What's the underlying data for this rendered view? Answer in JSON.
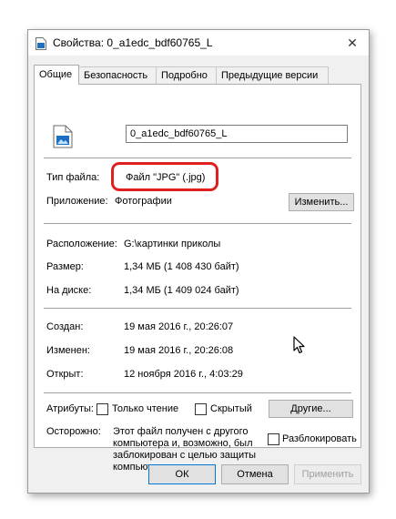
{
  "window": {
    "title": "Свойства: 0_a1edc_bdf60765_L",
    "close_glyph": "✕"
  },
  "tabs": [
    {
      "label": "Общие",
      "active": true
    },
    {
      "label": "Безопасность",
      "active": false
    },
    {
      "label": "Подробно",
      "active": false
    },
    {
      "label": "Предыдущие версии",
      "active": false
    }
  ],
  "general": {
    "file_name": "0_a1edc_bdf60765_L",
    "type_label": "Тип файла:",
    "type_value": "Файл \"JPG\" (.jpg)",
    "app_label": "Приложение:",
    "app_value": "Фотографии",
    "change_button": "Изменить...",
    "location_label": "Расположение:",
    "location_value": "G:\\картинки приколы",
    "size_label": "Размер:",
    "size_value": "1,34 МБ (1 408 430 байт)",
    "disk_label": "На диске:",
    "disk_value": "1,34 МБ (1 409 024 байт)",
    "created_label": "Создан:",
    "created_value": "19 мая 2016 г., 20:26:07",
    "modified_label": "Изменен:",
    "modified_value": "19 мая 2016 г., 20:26:08",
    "opened_label": "Открыт:",
    "opened_value": "12 ноября 2016 г., 4:03:29",
    "attributes_label": "Атрибуты:",
    "readonly_label": "Только чтение",
    "hidden_label": "Скрытый",
    "other_button": "Другие...",
    "caution_label": "Осторожно:",
    "caution_text": "Этот файл получен с другого\nкомпьютера и, возможно, был\nзаблокирован с целью защиты\nкомпьютера.",
    "unblock_label": "Разблокировать"
  },
  "footer": {
    "ok": "ОК",
    "cancel": "Отмена",
    "apply": "Применить"
  },
  "colors": {
    "highlight": "#e02020",
    "focus": "#0078d7",
    "icon_blue": "#1e6fc1"
  }
}
